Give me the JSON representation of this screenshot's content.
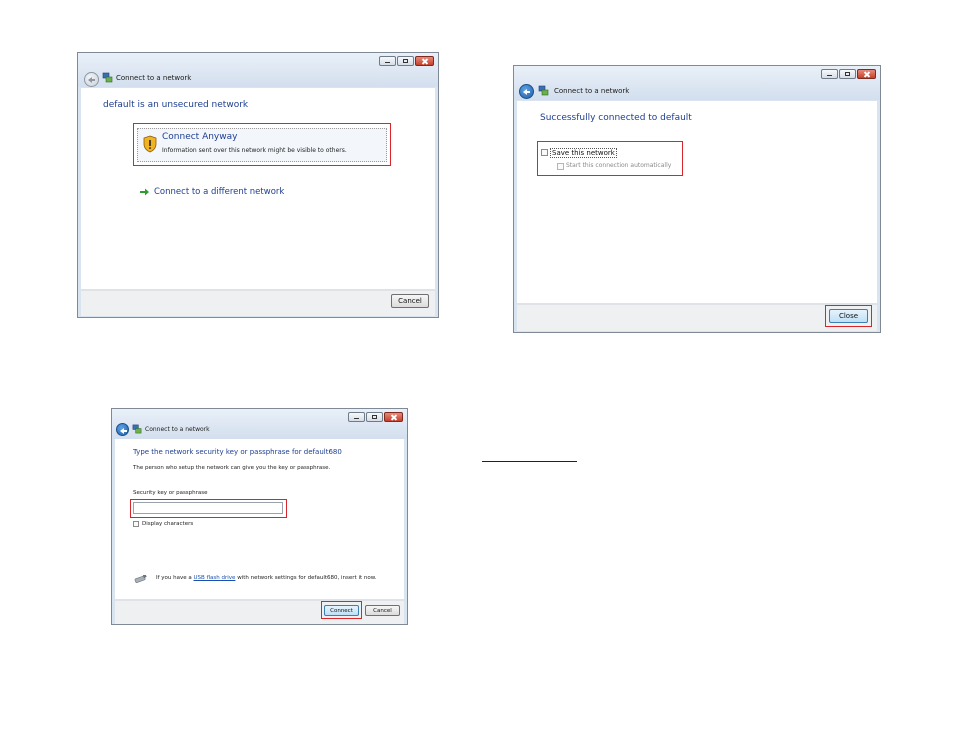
{
  "window_title": "Connect to a network",
  "dialog_unsecured": {
    "heading": "default is an unsecured network",
    "connect_anyway_title": "Connect Anyway",
    "connect_anyway_desc": "Information sent over this network might be visible to others.",
    "connect_different": "Connect to a different network",
    "cancel_label": "Cancel"
  },
  "dialog_connected": {
    "heading": "Successfully connected to default",
    "save_network_label": "Save this network",
    "start_auto_label": "Start this connection automatically",
    "close_label": "Close"
  },
  "dialog_key": {
    "heading": "Type the network security key or passphrase for default680",
    "subtext": "The person who setup the network can give you the key or passphrase.",
    "field_label": "Security key or passphrase",
    "field_value": "",
    "display_chars_label": "Display characters",
    "usb_text_before": "If you have a",
    "usb_link": "USB flash drive",
    "usb_text_after": "with network settings for default680, insert it now.",
    "connect_label": "Connect",
    "cancel_label": "Cancel"
  }
}
